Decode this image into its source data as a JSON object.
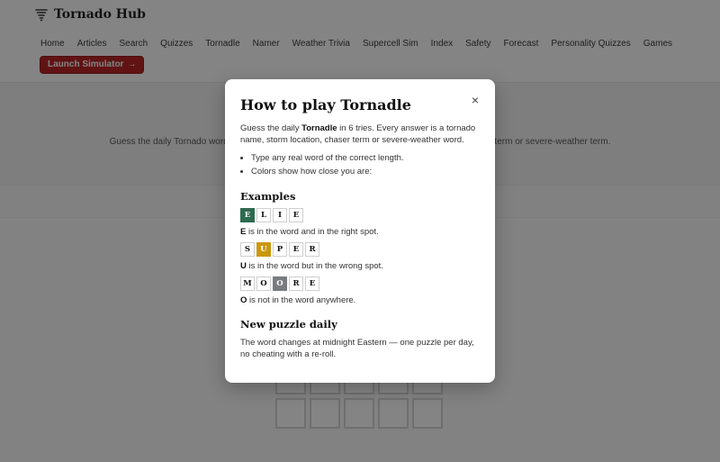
{
  "site": {
    "brand_name": "Tornado Hub",
    "nav": [
      "Home",
      "Articles",
      "Search",
      "Quizzes",
      "Tornadle",
      "Namer",
      "Weather Trivia",
      "Supercell Sim",
      "Index",
      "Safety",
      "Forecast",
      "Personality Quizzes",
      "Games"
    ],
    "launch_button": "Launch Simulator",
    "launch_arrow": "→",
    "accent_color": "#b91c1c",
    "hero_text": "Guess the daily Tornado word in 6 tries. Every answer is a tornado name, storm location, chaser term or severe-weather term."
  },
  "modal": {
    "title": "How to play Tornadle",
    "close_label": "×",
    "intro_prefix": "Guess the daily ",
    "intro_bold": "Tornadle",
    "intro_suffix": " in 6 tries. Every answer is a tornado name, storm location, chaser term or severe-weather word.",
    "rules": [
      "Type any real word of the correct length.",
      "Colors show how close you are:"
    ],
    "examples_heading": "Examples",
    "examples": [
      {
        "letters": [
          "E",
          "L",
          "I",
          "E"
        ],
        "highlight_index": 0,
        "state": "correct",
        "key_letter": "E",
        "description": " is in the word and in the right spot."
      },
      {
        "letters": [
          "S",
          "U",
          "P",
          "E",
          "R"
        ],
        "highlight_index": 1,
        "state": "present",
        "key_letter": "U",
        "description": " is in the word but in the wrong spot."
      },
      {
        "letters": [
          "M",
          "O",
          "O",
          "R",
          "E"
        ],
        "highlight_index": 2,
        "state": "absent",
        "key_letter": "O",
        "description": " is not in the word anywhere."
      }
    ],
    "daily_heading": "New puzzle daily",
    "daily_text": "The word changes at midnight Eastern — one puzzle per day, no cheating with a re-roll."
  },
  "colors": {
    "correct": "#2d6a4f",
    "present": "#c8990e",
    "absent": "#787c7e"
  }
}
